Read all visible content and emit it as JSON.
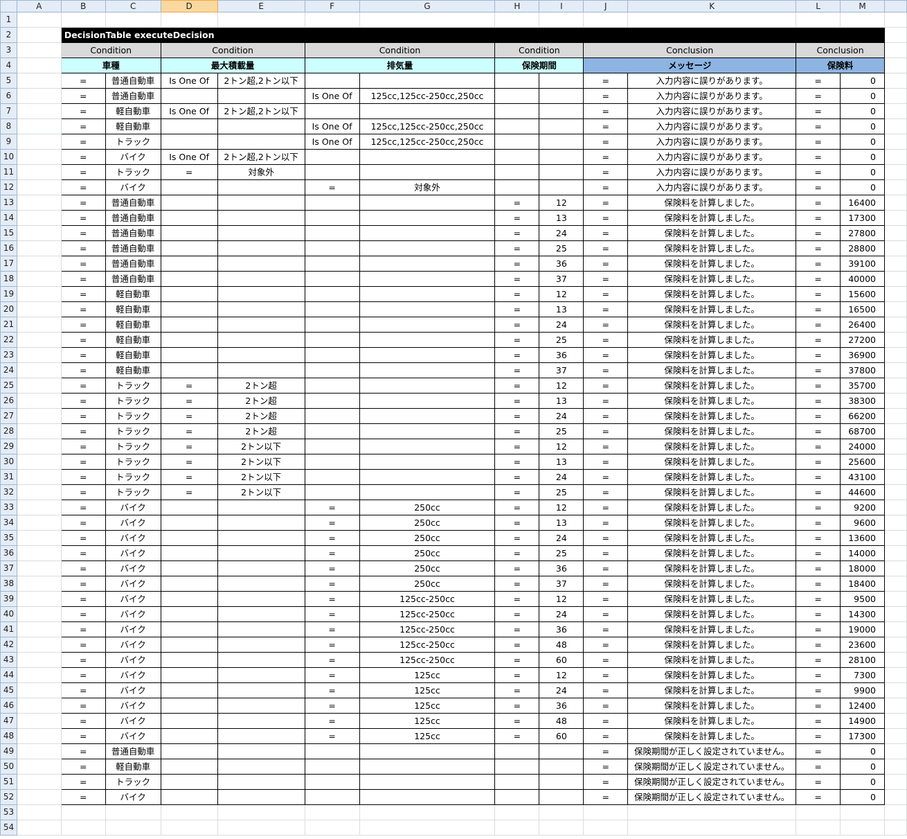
{
  "columns": [
    "A",
    "B",
    "C",
    "D",
    "E",
    "F",
    "G",
    "H",
    "I",
    "J",
    "K",
    "L",
    "M"
  ],
  "selected_column": "D",
  "sheet": {
    "title_row": 2,
    "title": "DecisionTable executeDecision",
    "kind_row": 3,
    "kinds": [
      "Condition",
      "Condition",
      "Condition",
      "Condition",
      "Conclusion",
      "Conclusion"
    ],
    "name_row": 4,
    "names": [
      "車種",
      "最大積載量",
      "排気量",
      "保険期間",
      "メッセージ",
      "保険料"
    ],
    "data_start_row": 5,
    "rows": [
      [
        "=",
        "普通自動車",
        "Is One Of",
        "2トン超,2トン以下",
        "",
        "",
        "",
        "",
        "=",
        "入力内容に誤りがあります。",
        "=",
        "0"
      ],
      [
        "=",
        "普通自動車",
        "",
        "",
        "Is One Of",
        "125cc,125cc-250cc,250cc",
        "",
        "",
        "=",
        "入力内容に誤りがあります。",
        "=",
        "0"
      ],
      [
        "=",
        "軽自動車",
        "Is One Of",
        "2トン超,2トン以下",
        "",
        "",
        "",
        "",
        "=",
        "入力内容に誤りがあります。",
        "=",
        "0"
      ],
      [
        "=",
        "軽自動車",
        "",
        "",
        "Is One Of",
        "125cc,125cc-250cc,250cc",
        "",
        "",
        "=",
        "入力内容に誤りがあります。",
        "=",
        "0"
      ],
      [
        "=",
        "トラック",
        "",
        "",
        "Is One Of",
        "125cc,125cc-250cc,250cc",
        "",
        "",
        "=",
        "入力内容に誤りがあります。",
        "=",
        "0"
      ],
      [
        "=",
        "バイク",
        "Is One Of",
        "2トン超,2トン以下",
        "",
        "",
        "",
        "",
        "=",
        "入力内容に誤りがあります。",
        "=",
        "0"
      ],
      [
        "=",
        "トラック",
        "=",
        "対象外",
        "",
        "",
        "",
        "",
        "=",
        "入力内容に誤りがあります。",
        "=",
        "0"
      ],
      [
        "=",
        "バイク",
        "",
        "",
        "=",
        "対象外",
        "",
        "",
        "=",
        "入力内容に誤りがあります。",
        "=",
        "0"
      ],
      [
        "=",
        "普通自動車",
        "",
        "",
        "",
        "",
        "=",
        "12",
        "=",
        "保険料を計算しました。",
        "=",
        "16400"
      ],
      [
        "=",
        "普通自動車",
        "",
        "",
        "",
        "",
        "=",
        "13",
        "=",
        "保険料を計算しました。",
        "=",
        "17300"
      ],
      [
        "=",
        "普通自動車",
        "",
        "",
        "",
        "",
        "=",
        "24",
        "=",
        "保険料を計算しました。",
        "=",
        "27800"
      ],
      [
        "=",
        "普通自動車",
        "",
        "",
        "",
        "",
        "=",
        "25",
        "=",
        "保険料を計算しました。",
        "=",
        "28800"
      ],
      [
        "=",
        "普通自動車",
        "",
        "",
        "",
        "",
        "=",
        "36",
        "=",
        "保険料を計算しました。",
        "=",
        "39100"
      ],
      [
        "=",
        "普通自動車",
        "",
        "",
        "",
        "",
        "=",
        "37",
        "=",
        "保険料を計算しました。",
        "=",
        "40000"
      ],
      [
        "=",
        "軽自動車",
        "",
        "",
        "",
        "",
        "=",
        "12",
        "=",
        "保険料を計算しました。",
        "=",
        "15600"
      ],
      [
        "=",
        "軽自動車",
        "",
        "",
        "",
        "",
        "=",
        "13",
        "=",
        "保険料を計算しました。",
        "=",
        "16500"
      ],
      [
        "=",
        "軽自動車",
        "",
        "",
        "",
        "",
        "=",
        "24",
        "=",
        "保険料を計算しました。",
        "=",
        "26400"
      ],
      [
        "=",
        "軽自動車",
        "",
        "",
        "",
        "",
        "=",
        "25",
        "=",
        "保険料を計算しました。",
        "=",
        "27200"
      ],
      [
        "=",
        "軽自動車",
        "",
        "",
        "",
        "",
        "=",
        "36",
        "=",
        "保険料を計算しました。",
        "=",
        "36900"
      ],
      [
        "=",
        "軽自動車",
        "",
        "",
        "",
        "",
        "=",
        "37",
        "=",
        "保険料を計算しました。",
        "=",
        "37800"
      ],
      [
        "=",
        "トラック",
        "=",
        "2トン超",
        "",
        "",
        "=",
        "12",
        "=",
        "保険料を計算しました。",
        "=",
        "35700"
      ],
      [
        "=",
        "トラック",
        "=",
        "2トン超",
        "",
        "",
        "=",
        "13",
        "=",
        "保険料を計算しました。",
        "=",
        "38300"
      ],
      [
        "=",
        "トラック",
        "=",
        "2トン超",
        "",
        "",
        "=",
        "24",
        "=",
        "保険料を計算しました。",
        "=",
        "66200"
      ],
      [
        "=",
        "トラック",
        "=",
        "2トン超",
        "",
        "",
        "=",
        "25",
        "=",
        "保険料を計算しました。",
        "=",
        "68700"
      ],
      [
        "=",
        "トラック",
        "=",
        "2トン以下",
        "",
        "",
        "=",
        "12",
        "=",
        "保険料を計算しました。",
        "=",
        "24000"
      ],
      [
        "=",
        "トラック",
        "=",
        "2トン以下",
        "",
        "",
        "=",
        "13",
        "=",
        "保険料を計算しました。",
        "=",
        "25600"
      ],
      [
        "=",
        "トラック",
        "=",
        "2トン以下",
        "",
        "",
        "=",
        "24",
        "=",
        "保険料を計算しました。",
        "=",
        "43100"
      ],
      [
        "=",
        "トラック",
        "=",
        "2トン以下",
        "",
        "",
        "=",
        "25",
        "=",
        "保険料を計算しました。",
        "=",
        "44600"
      ],
      [
        "=",
        "バイク",
        "",
        "",
        "=",
        "250cc",
        "=",
        "12",
        "=",
        "保険料を計算しました。",
        "=",
        "9200"
      ],
      [
        "=",
        "バイク",
        "",
        "",
        "=",
        "250cc",
        "=",
        "13",
        "=",
        "保険料を計算しました。",
        "=",
        "9600"
      ],
      [
        "=",
        "バイク",
        "",
        "",
        "=",
        "250cc",
        "=",
        "24",
        "=",
        "保険料を計算しました。",
        "=",
        "13600"
      ],
      [
        "=",
        "バイク",
        "",
        "",
        "=",
        "250cc",
        "=",
        "25",
        "=",
        "保険料を計算しました。",
        "=",
        "14000"
      ],
      [
        "=",
        "バイク",
        "",
        "",
        "=",
        "250cc",
        "=",
        "36",
        "=",
        "保険料を計算しました。",
        "=",
        "18000"
      ],
      [
        "=",
        "バイク",
        "",
        "",
        "=",
        "250cc",
        "=",
        "37",
        "=",
        "保険料を計算しました。",
        "=",
        "18400"
      ],
      [
        "=",
        "バイク",
        "",
        "",
        "=",
        "125cc-250cc",
        "=",
        "12",
        "=",
        "保険料を計算しました。",
        "=",
        "9500"
      ],
      [
        "=",
        "バイク",
        "",
        "",
        "=",
        "125cc-250cc",
        "=",
        "24",
        "=",
        "保険料を計算しました。",
        "=",
        "14300"
      ],
      [
        "=",
        "バイク",
        "",
        "",
        "=",
        "125cc-250cc",
        "=",
        "36",
        "=",
        "保険料を計算しました。",
        "=",
        "19000"
      ],
      [
        "=",
        "バイク",
        "",
        "",
        "=",
        "125cc-250cc",
        "=",
        "48",
        "=",
        "保険料を計算しました。",
        "=",
        "23600"
      ],
      [
        "=",
        "バイク",
        "",
        "",
        "=",
        "125cc-250cc",
        "=",
        "60",
        "=",
        "保険料を計算しました。",
        "=",
        "28100"
      ],
      [
        "=",
        "バイク",
        "",
        "",
        "=",
        "125cc",
        "=",
        "12",
        "=",
        "保険料を計算しました。",
        "=",
        "7300"
      ],
      [
        "=",
        "バイク",
        "",
        "",
        "=",
        "125cc",
        "=",
        "24",
        "=",
        "保険料を計算しました。",
        "=",
        "9900"
      ],
      [
        "=",
        "バイク",
        "",
        "",
        "=",
        "125cc",
        "=",
        "36",
        "=",
        "保険料を計算しました。",
        "=",
        "12400"
      ],
      [
        "=",
        "バイク",
        "",
        "",
        "=",
        "125cc",
        "=",
        "48",
        "=",
        "保険料を計算しました。",
        "=",
        "14900"
      ],
      [
        "=",
        "バイク",
        "",
        "",
        "=",
        "125cc",
        "=",
        "60",
        "=",
        "保険料を計算しました。",
        "=",
        "17300"
      ],
      [
        "=",
        "普通自動車",
        "",
        "",
        "",
        "",
        "",
        "",
        "=",
        "保険期間が正しく設定されていません。",
        "=",
        "0"
      ],
      [
        "=",
        "軽自動車",
        "",
        "",
        "",
        "",
        "",
        "",
        "=",
        "保険期間が正しく設定されていません。",
        "=",
        "0"
      ],
      [
        "=",
        "トラック",
        "",
        "",
        "",
        "",
        "",
        "",
        "=",
        "保険期間が正しく設定されていません。",
        "=",
        "0"
      ],
      [
        "=",
        "バイク",
        "",
        "",
        "",
        "",
        "",
        "",
        "=",
        "保険期間が正しく設定されていません。",
        "=",
        "0"
      ]
    ],
    "trailing_empty_rows": [
      53,
      54
    ]
  }
}
